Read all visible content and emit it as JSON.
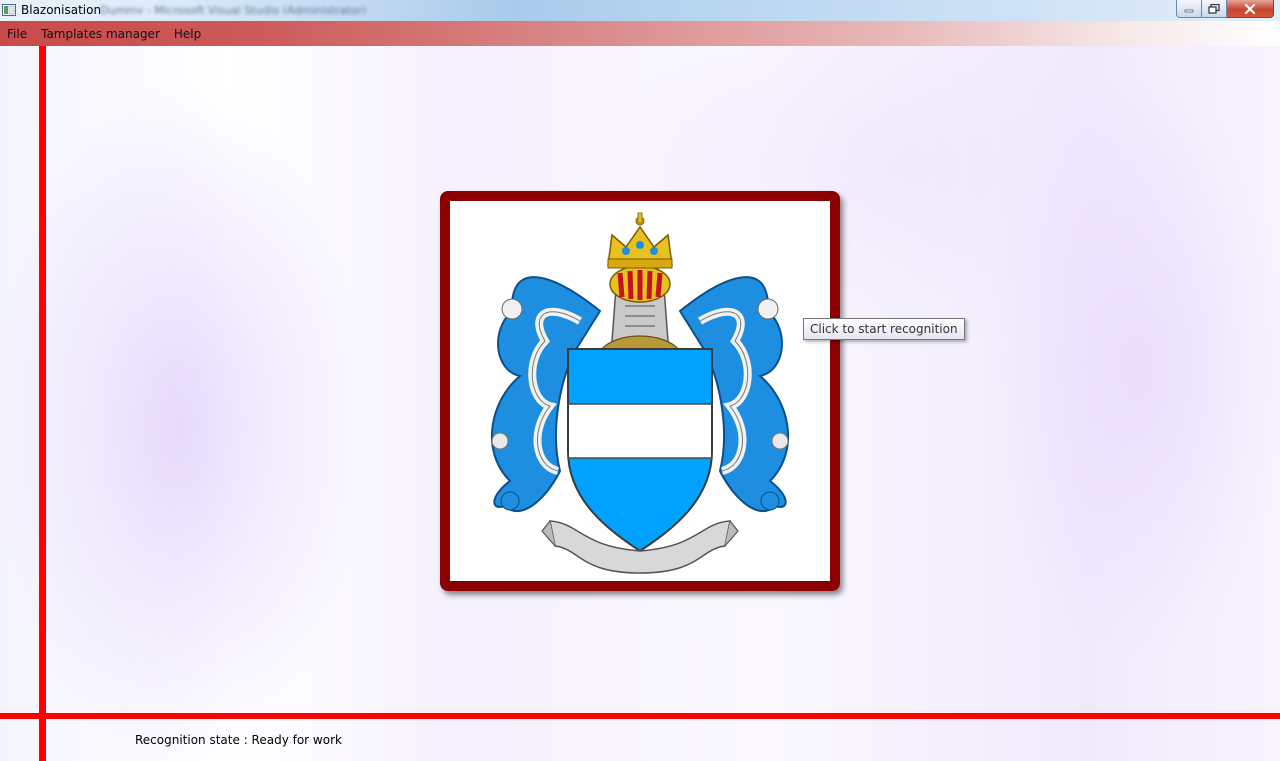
{
  "window": {
    "title": "Blazonisation",
    "background_caption": "Dummy - Microsoft Visual Studio (Administrator)",
    "buttons": {
      "minimize": "minimize-icon",
      "maximize": "restore-icon",
      "close": "close-icon"
    }
  },
  "menu": {
    "items": [
      "File",
      "Tamplates manager",
      "Help"
    ]
  },
  "image_panel": {
    "icon": "coat-of-arms-image",
    "frame_color": "#8b0000",
    "tooltip": "Click to start recognition"
  },
  "status_bar": {
    "text": "Recognition state : Ready for work"
  },
  "colors": {
    "divider": "#ff0000",
    "menu_start": "#c94a4a",
    "shield_blue": "#00a2ff",
    "mantling_blue": "#1e8fe0"
  }
}
